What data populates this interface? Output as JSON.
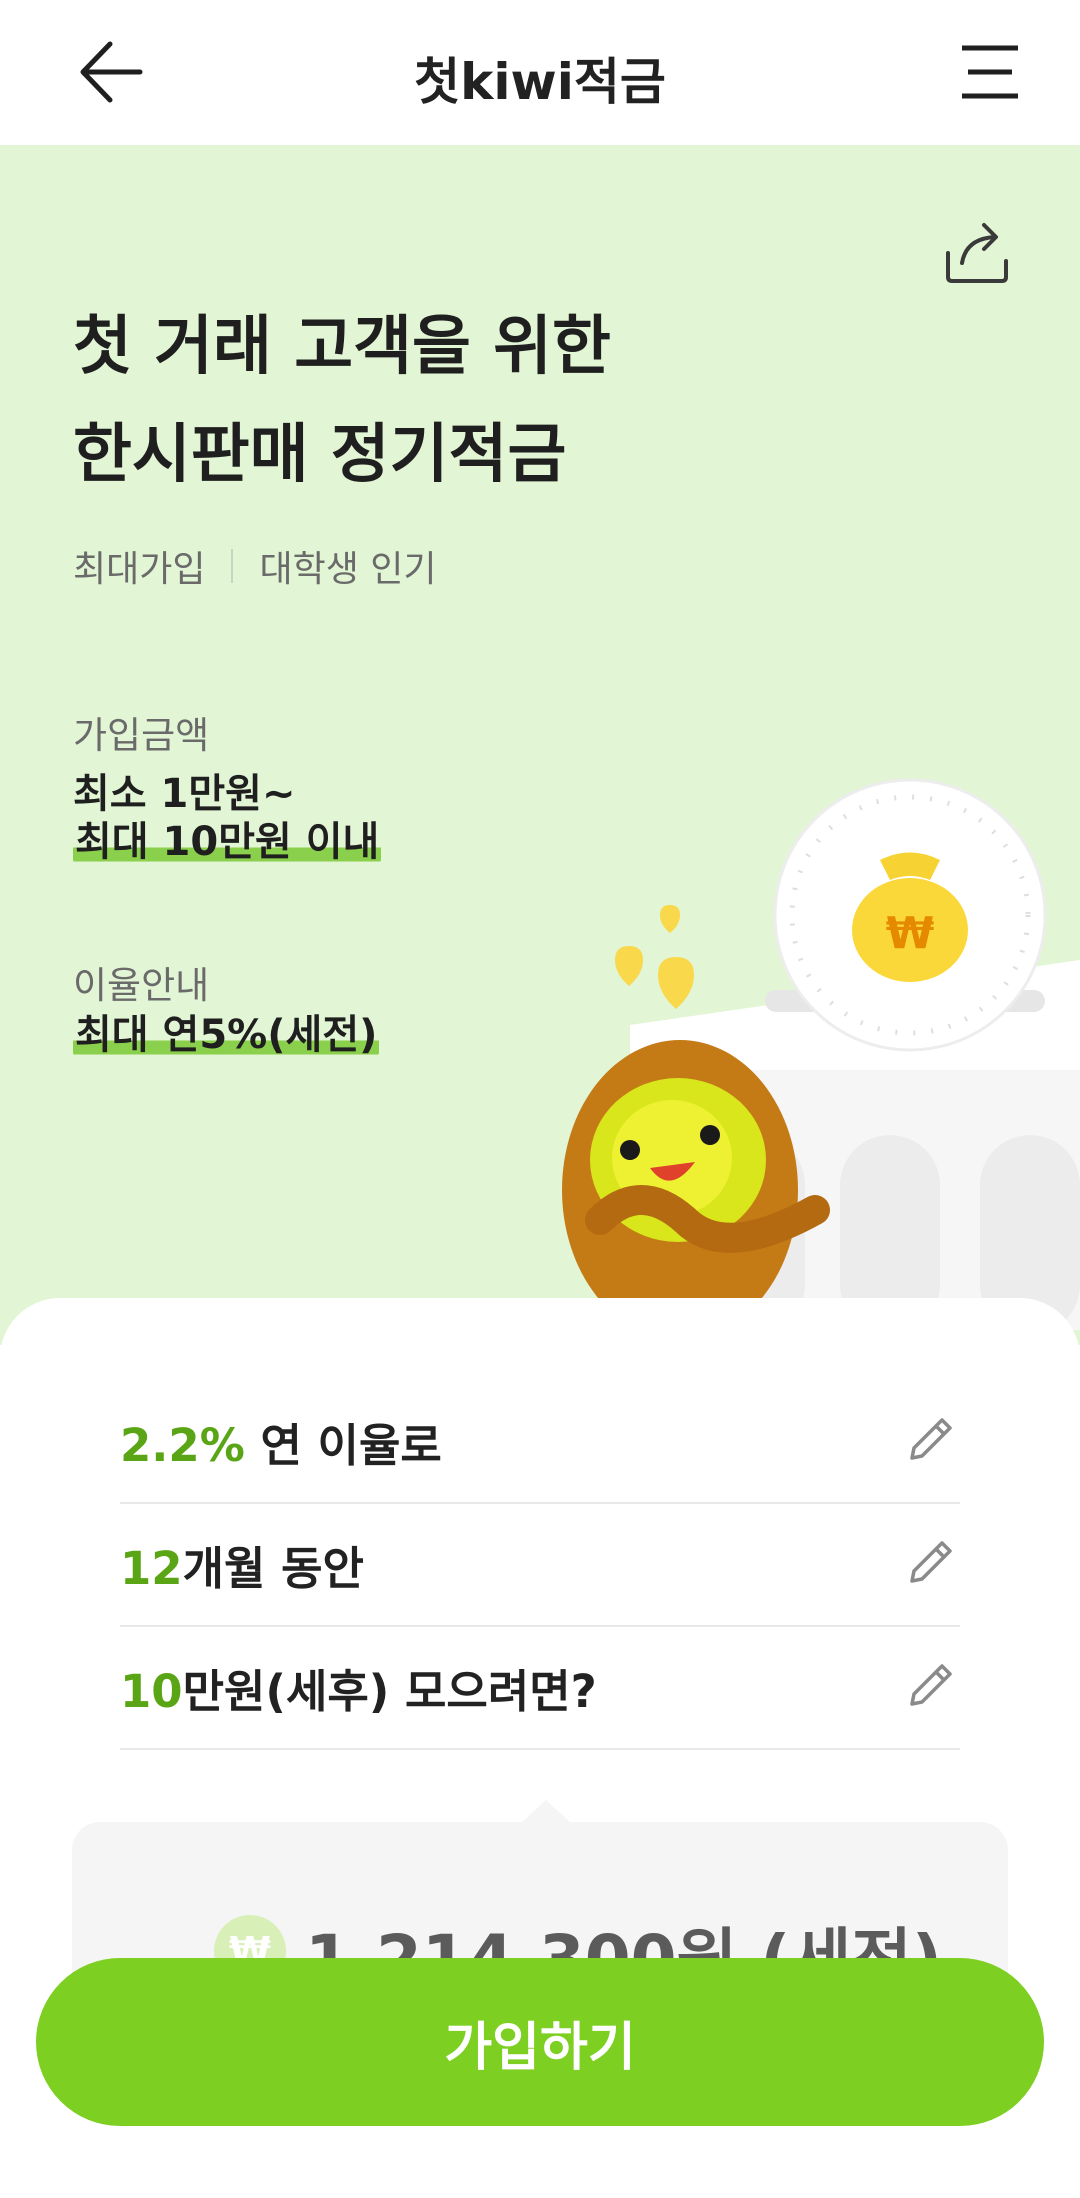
{
  "header": {
    "title": "첫kiwi적금",
    "back_icon": "arrow-left-icon",
    "menu_icon": "menu-icon"
  },
  "hero": {
    "headline_line1": "첫 거래 고객을 위한",
    "headline_line2": "한시판매 정기적금",
    "tags": [
      "최대가입",
      "대학생 인기"
    ],
    "amount_label": "가입금액",
    "amount_line1": "최소 1만원~",
    "amount_line2": "최대 10만원 이내",
    "rate_label": "이율안내",
    "rate_value": "최대 연5%(세전)",
    "share_icon": "share-icon"
  },
  "calculator": {
    "rows": [
      {
        "accent": "2.2%",
        "text": " 연 이율로",
        "icon": "pencil-icon"
      },
      {
        "accent": "12",
        "text": "개월 동안",
        "icon": "pencil-icon"
      },
      {
        "accent": "10",
        "text": "만원(세후) 모으려면?",
        "icon": "pencil-icon"
      }
    ],
    "result_symbol": "₩",
    "result_amount": "1,214,300원 (세전)"
  },
  "cta": {
    "join_label": "가입하기"
  },
  "colors": {
    "hero_bg": "#e2f5d4",
    "accent_green": "#5aa516",
    "button_green": "#7dcf22",
    "highlight": "#8bd04d"
  }
}
